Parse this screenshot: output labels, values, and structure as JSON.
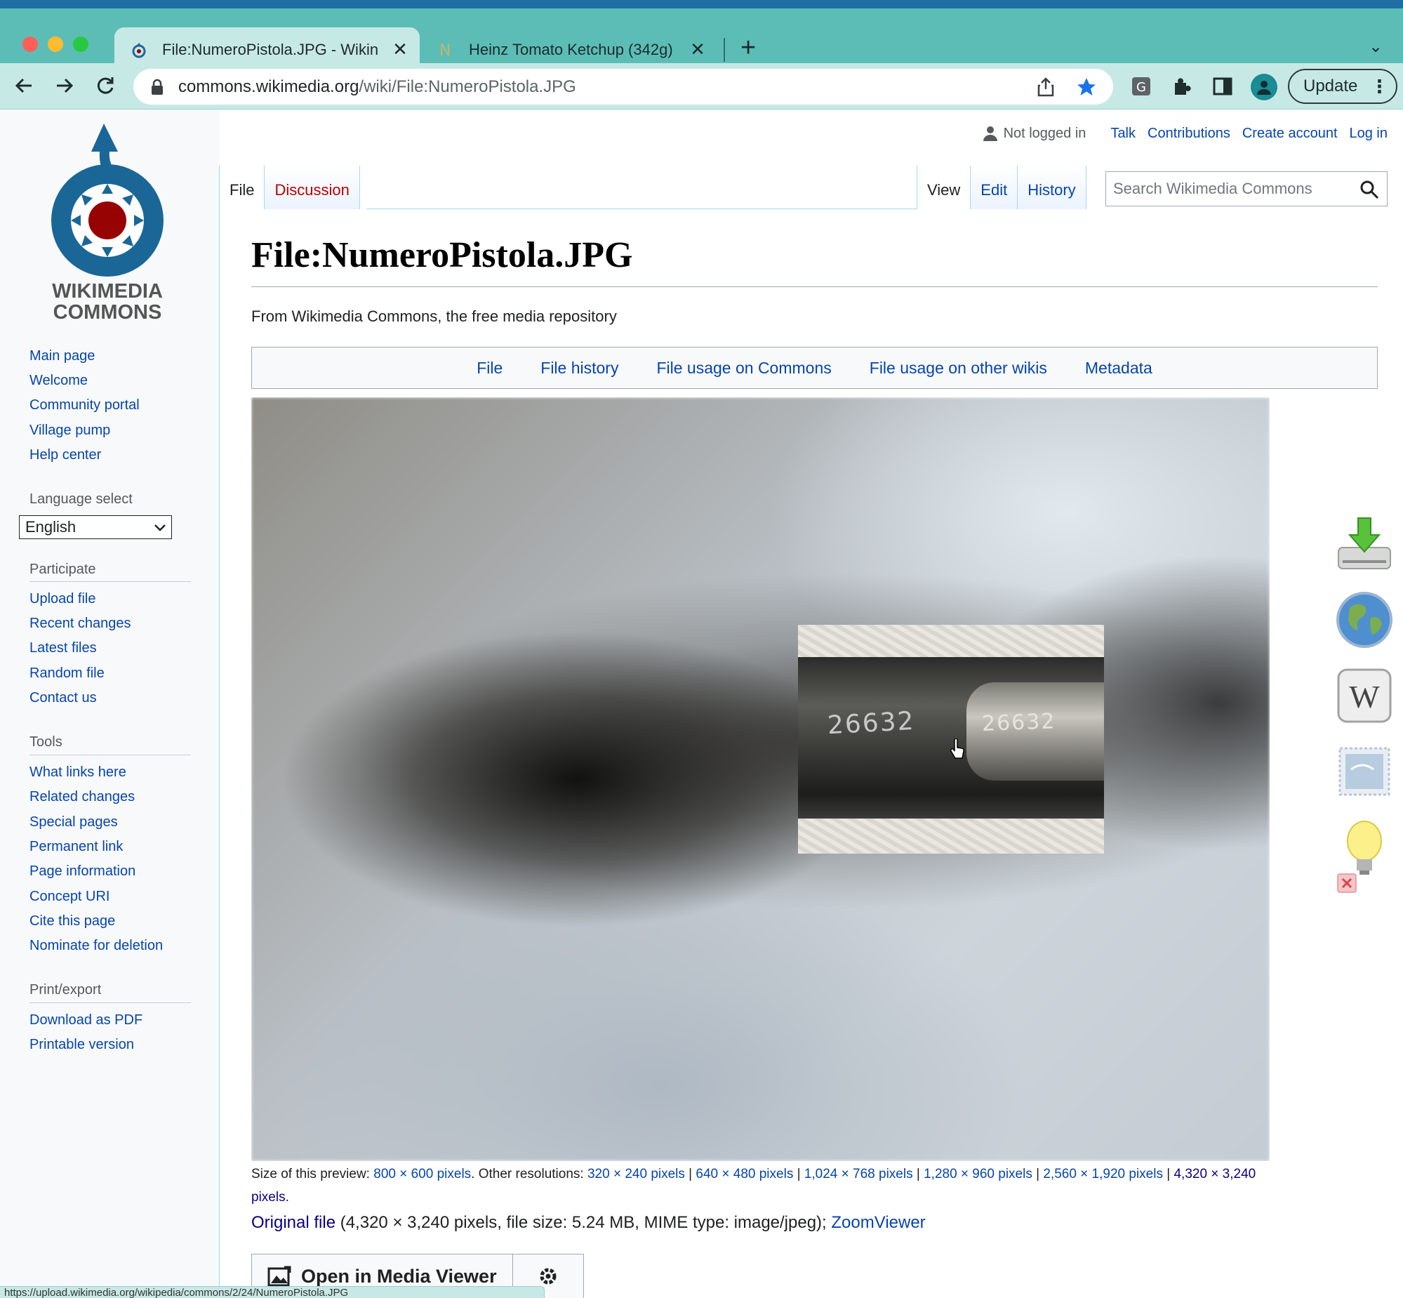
{
  "browser": {
    "tabs": [
      {
        "title": "File:NumeroPistola.JPG - Wikin",
        "active": true
      },
      {
        "title": "Heinz Tomato Ketchup (342g)",
        "active": false
      }
    ],
    "url_host": "commons.wikimedia.org",
    "url_path": "/wiki/File:NumeroPistola.JPG",
    "update_label": "Update",
    "status_url": "https://upload.wikimedia.org/wikipedia/commons/2/24/NumeroPistola.JPG"
  },
  "personal": {
    "not_logged_in": "Not logged in",
    "talk": "Talk",
    "contributions": "Contributions",
    "create_account": "Create account",
    "log_in": "Log in"
  },
  "logo": {
    "line1": "WIKIMEDIA",
    "line2": "COMMONS"
  },
  "sidebar": {
    "nav": [
      "Main page",
      "Welcome",
      "Community portal",
      "Village pump",
      "Help center"
    ],
    "language_heading": "Language select",
    "language_value": "English",
    "participate_heading": "Participate",
    "participate": [
      "Upload file",
      "Recent changes",
      "Latest files",
      "Random file",
      "Contact us"
    ],
    "tools_heading": "Tools",
    "tools": [
      "What links here",
      "Related changes",
      "Special pages",
      "Permanent link",
      "Page information",
      "Concept URI",
      "Cite this page",
      "Nominate for deletion"
    ],
    "print_heading": "Print/export",
    "print": [
      "Download as PDF",
      "Printable version"
    ]
  },
  "page_tabs": {
    "file": "File",
    "discussion": "Discussion",
    "view": "View",
    "edit": "Edit",
    "history": "History"
  },
  "search": {
    "placeholder": "Search Wikimedia Commons"
  },
  "content": {
    "title": "File:NumeroPistola.JPG",
    "subtitle": "From Wikimedia Commons, the free media repository",
    "filetoc": [
      "File",
      "File history",
      "File usage on Commons",
      "File usage on other wikis",
      "Metadata"
    ],
    "serial_number": "26632",
    "preview_label": "Size of this preview:",
    "preview_size": "800 × 600 pixels",
    "other_label": "Other resolutions:",
    "resolutions": [
      "320 × 240 pixels",
      "640 × 480 pixels",
      "1,024 × 768 pixels",
      "1,280 × 960 pixels",
      "2,560 × 1,920 pixels"
    ],
    "full_resolution_a": "4,320 × 3,240",
    "full_resolution_b": "pixels",
    "original_file_link": "Original file",
    "original_file_info": "(4,320 × 3,240 pixels, file size: 5.24 MB, MIME type: image/jpeg);",
    "zoomviewer": "ZoomViewer",
    "media_viewer_button": "Open in Media Viewer"
  },
  "right_icons": [
    "download-icon",
    "globe-icon",
    "wikipedia-icon",
    "stamp-icon",
    "lightbulb-icon",
    "close-icon"
  ]
}
